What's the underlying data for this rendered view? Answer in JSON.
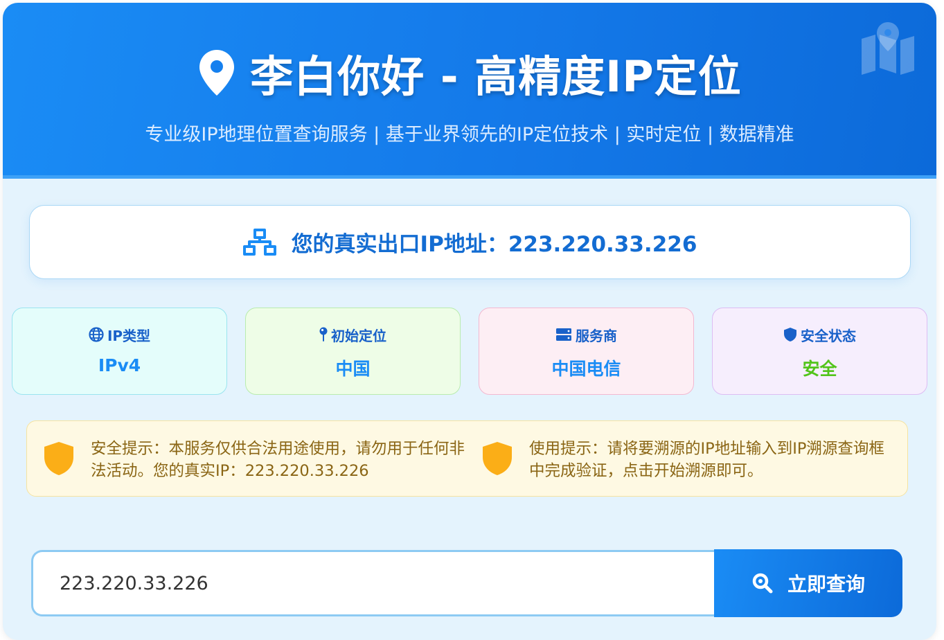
{
  "header": {
    "title": "李白你好 - 高精度IP定位",
    "subtitle": "专业级IP地理位置查询服务 | 基于业界领先的IP定位技术 | 实时定位 | 数据精准"
  },
  "ip_banner": {
    "text": "您的真实出口IP地址：223.220.33.226"
  },
  "stats": [
    {
      "label": "IP类型",
      "value": "IPv4",
      "icon": "globe-icon",
      "value_color": "#1a8cf5",
      "bg": "#e4fdfb",
      "border": "#9ae4ef"
    },
    {
      "label": "初始定位",
      "value": "中国",
      "icon": "map-pin-icon",
      "value_color": "#1a8cf5",
      "bg": "#eefde7",
      "border": "#b9ecae"
    },
    {
      "label": "服务商",
      "value": "中国电信",
      "icon": "server-icon",
      "value_color": "#1a8cf5",
      "bg": "#fdeef4",
      "border": "#f3b8d0"
    },
    {
      "label": "安全状态",
      "value": "安全",
      "icon": "shield-icon",
      "value_color": "#52c41a",
      "bg": "#f6eefd",
      "border": "#dcbcf3"
    }
  ],
  "tips": [
    {
      "text": "安全提示：本服务仅供合法用途使用，请勿用于任何非法活动。您的真实IP：223.220.33.226"
    },
    {
      "text": "使用提示：请将要溯源的IP地址输入到IP溯源查询框中完成验证，点击开始溯源即可。"
    }
  ],
  "search": {
    "value": "223.220.33.226",
    "button_label": "立即查询"
  },
  "colors": {
    "accent": "#1a8cf5",
    "header_gradient_end": "#0c6ad9",
    "page_bg": "#e4f3fd",
    "tip_text": "#8a6514",
    "warning": "#fbae17",
    "safe": "#52c41a"
  }
}
